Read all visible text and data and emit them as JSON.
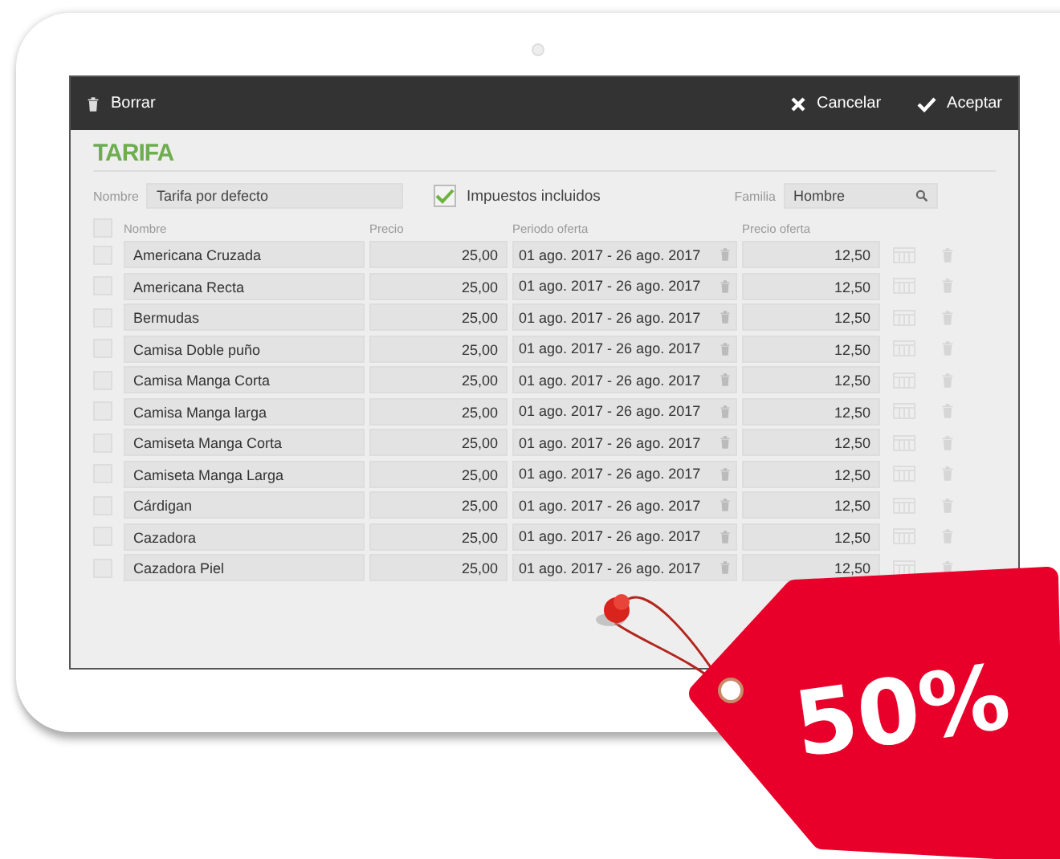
{
  "toolbar": {
    "delete_label": "Borrar",
    "cancel_label": "Cancelar",
    "accept_label": "Aceptar"
  },
  "title": "TARIFA",
  "form": {
    "name_label": "Nombre",
    "name_value": "Tarifa por defecto",
    "taxes": {
      "label": "Impuestos incluidos",
      "checked": true
    },
    "family_label": "Familia",
    "family_value": "Hombre"
  },
  "select_all": {
    "checked": false
  },
  "columns": [
    "Nombre",
    "Precio",
    "Periodo oferta",
    "Precio oferta"
  ],
  "rows": [
    {
      "name": "Americana Cruzada",
      "price": "25,00",
      "period": "01 ago. 2017 - 26 ago. 2017",
      "offer_price": "12,50",
      "checked": false
    },
    {
      "name": "Americana Recta",
      "price": "25,00",
      "period": "01 ago. 2017 - 26 ago. 2017",
      "offer_price": "12,50",
      "checked": false
    },
    {
      "name": "Bermudas",
      "price": "25,00",
      "period": "01 ago. 2017 - 26 ago. 2017",
      "offer_price": "12,50",
      "checked": false
    },
    {
      "name": "Camisa Doble puño",
      "price": "25,00",
      "period": "01 ago. 2017 - 26 ago. 2017",
      "offer_price": "12,50",
      "checked": false
    },
    {
      "name": "Camisa Manga Corta",
      "price": "25,00",
      "period": "01 ago. 2017 - 26 ago. 2017",
      "offer_price": "12,50",
      "checked": false
    },
    {
      "name": "Camisa Manga larga",
      "price": "25,00",
      "period": "01 ago. 2017 - 26 ago. 2017",
      "offer_price": "12,50",
      "checked": false
    },
    {
      "name": "Camiseta Manga Corta",
      "price": "25,00",
      "period": "01 ago. 2017 - 26 ago. 2017",
      "offer_price": "12,50",
      "checked": false
    },
    {
      "name": "Camiseta Manga Larga",
      "price": "25,00",
      "period": "01 ago. 2017 - 26 ago. 2017",
      "offer_price": "12,50",
      "checked": false
    },
    {
      "name": "Cárdigan",
      "price": "25,00",
      "period": "01 ago. 2017 - 26 ago. 2017",
      "offer_price": "12,50",
      "checked": false
    },
    {
      "name": "Cazadora",
      "price": "25,00",
      "period": "01 ago. 2017 - 26 ago. 2017",
      "offer_price": "12,50",
      "checked": false
    },
    {
      "name": "Cazadora Piel",
      "price": "25,00",
      "period": "01 ago. 2017 - 26 ago. 2017",
      "offer_price": "12,50",
      "checked": false
    }
  ],
  "tag": {
    "text": "50%"
  }
}
